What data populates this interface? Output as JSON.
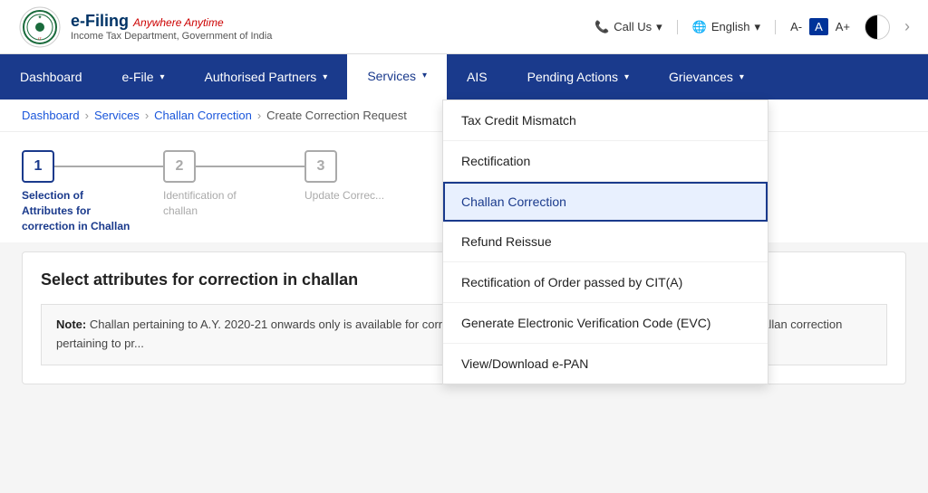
{
  "topbar": {
    "logo_efiling": "e-Filing",
    "logo_anywhere": "Anywhere Anytime",
    "logo_subtitle": "Income Tax Department, Government of India",
    "call_us": "Call Us",
    "language": "English",
    "font_small": "A-",
    "font_normal": "A",
    "font_large": "A+"
  },
  "nav": {
    "items": [
      {
        "label": "Dashboard",
        "arrow": false,
        "id": "dashboard"
      },
      {
        "label": "e-File",
        "arrow": true,
        "id": "efile"
      },
      {
        "label": "Authorised Partners",
        "arrow": true,
        "id": "partners"
      },
      {
        "label": "Services",
        "arrow": true,
        "id": "services"
      },
      {
        "label": "AIS",
        "arrow": false,
        "id": "ais"
      },
      {
        "label": "Pending Actions",
        "arrow": true,
        "id": "pending"
      },
      {
        "label": "Grievances",
        "arrow": true,
        "id": "grievances"
      }
    ]
  },
  "breadcrumb": {
    "items": [
      {
        "label": "Dashboard",
        "link": true
      },
      {
        "label": "Services",
        "link": true
      },
      {
        "label": "Challan Correction",
        "link": true
      },
      {
        "label": "Create Correction Request",
        "link": false
      }
    ]
  },
  "stepper": {
    "steps": [
      {
        "number": "1",
        "label": "Selection of Attributes for correction in Challan",
        "active": true
      },
      {
        "number": "2",
        "label": "Identification of challan",
        "active": false
      },
      {
        "number": "3",
        "label": "Update Correc...",
        "active": false
      }
    ]
  },
  "main": {
    "section_title": "Select attributes for correction in challan",
    "note_label": "Note:",
    "note_text": "Challan pertaining to A.Y. 2020-21 onwards only is available for correction on this portal. Kindly approach Assessing Officer for challan correction pertaining to pr..."
  },
  "dropdown": {
    "items": [
      {
        "label": "Tax Credit Mismatch",
        "selected": false,
        "id": "tax-credit"
      },
      {
        "label": "Rectification",
        "selected": false,
        "id": "rectification"
      },
      {
        "label": "Challan Correction",
        "selected": true,
        "id": "challan-correction"
      },
      {
        "label": "Refund Reissue",
        "selected": false,
        "id": "refund-reissue"
      },
      {
        "label": "Rectification of Order passed by CIT(A)",
        "selected": false,
        "id": "rectification-cit"
      },
      {
        "label": "Generate Electronic Verification Code (EVC)",
        "selected": false,
        "id": "evc"
      },
      {
        "label": "View/Download e-PAN",
        "selected": false,
        "id": "epan"
      }
    ]
  }
}
